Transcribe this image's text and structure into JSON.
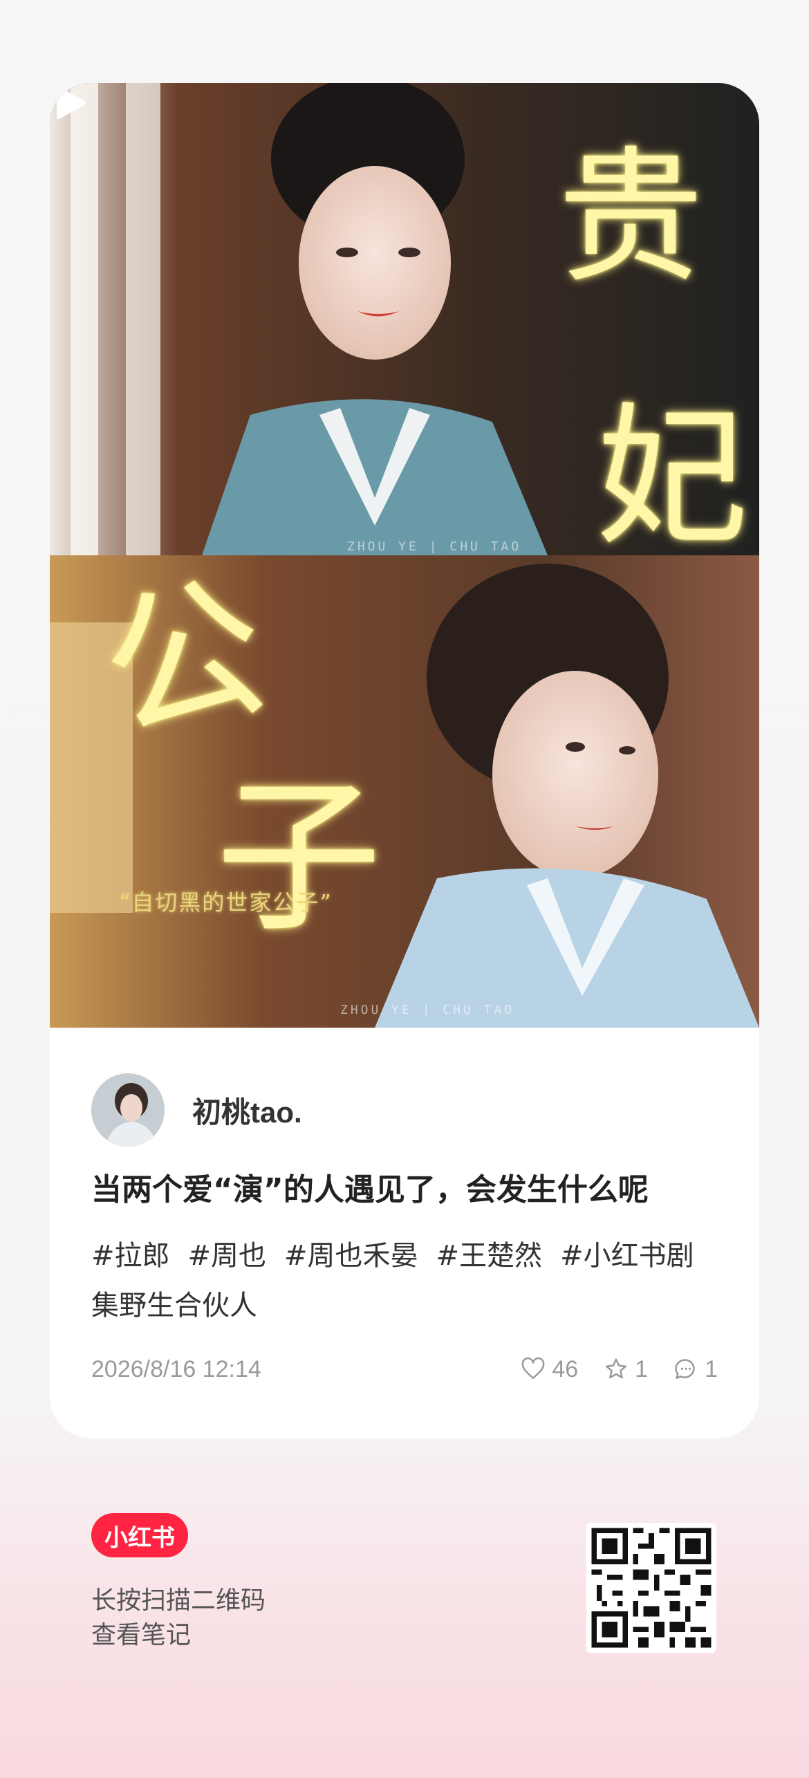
{
  "post": {
    "cover": {
      "overlay_gui": "贵",
      "overlay_fei": "妃",
      "overlay_gong": "公",
      "overlay_zi": "子",
      "quote": "“自切黑的世家公子”",
      "watermark": "ZHOU YE | CHU TAO"
    },
    "author": {
      "name": "初桃tao."
    },
    "title": "当两个爱“演”的人遇见了，会发生什么呢",
    "tags": [
      "#拉郎",
      "#周也",
      "#周也禾晏",
      "#王楚然",
      "#小红书剧",
      "集野生合伙人"
    ],
    "date": "2026/8/16 12:14",
    "stats": {
      "likes": "46",
      "favorites": "1",
      "comments": "1"
    }
  },
  "footer": {
    "brand": "小红书",
    "hint_line1": "长按扫描二维码",
    "hint_line2": "查看笔记"
  },
  "icons": {
    "play": "play-icon",
    "like": "heart-icon",
    "favorite": "star-icon",
    "comment": "comment-icon"
  },
  "colors": {
    "brand_red": "#ff2442",
    "overlay_yellow": "#fff6a8"
  }
}
